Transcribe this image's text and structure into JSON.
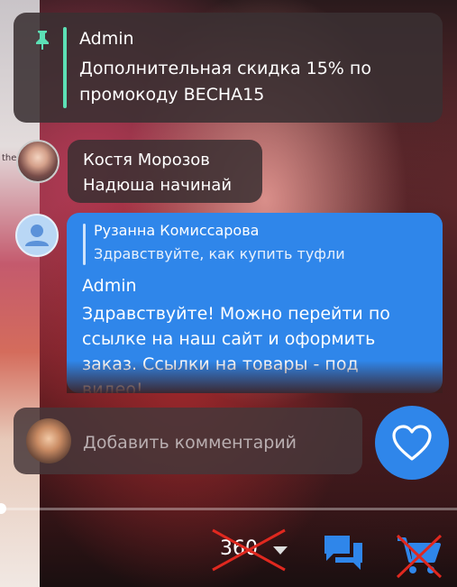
{
  "side_text": "the",
  "pinned": {
    "author": "Admin",
    "text": "Дополнительная скидка 15% по промокоду ВЕСНА15",
    "pin_color": "#5ce0b5"
  },
  "comments": [
    {
      "author": "Костя Морозов",
      "text": "Надюша начинай"
    }
  ],
  "reply": {
    "quoted_author": "Рузанна Комиссарова",
    "quoted_text": "Здравствуйте, как купить туфли",
    "author": "Admin",
    "text": "Здравствуйте! Можно перейти по ссылке на наш сайт и оформить заказ. Ссылки на товары - под видео!"
  },
  "comment_input": {
    "placeholder": "Добавить комментарий"
  },
  "playback": {
    "progress": 0.0
  },
  "bottom_bar": {
    "viewers_label": "360",
    "icons": [
      "chat-icon",
      "cart-icon",
      "heart-icon"
    ]
  },
  "colors": {
    "accent": "#2f86ea",
    "cross": "#e0281f"
  }
}
